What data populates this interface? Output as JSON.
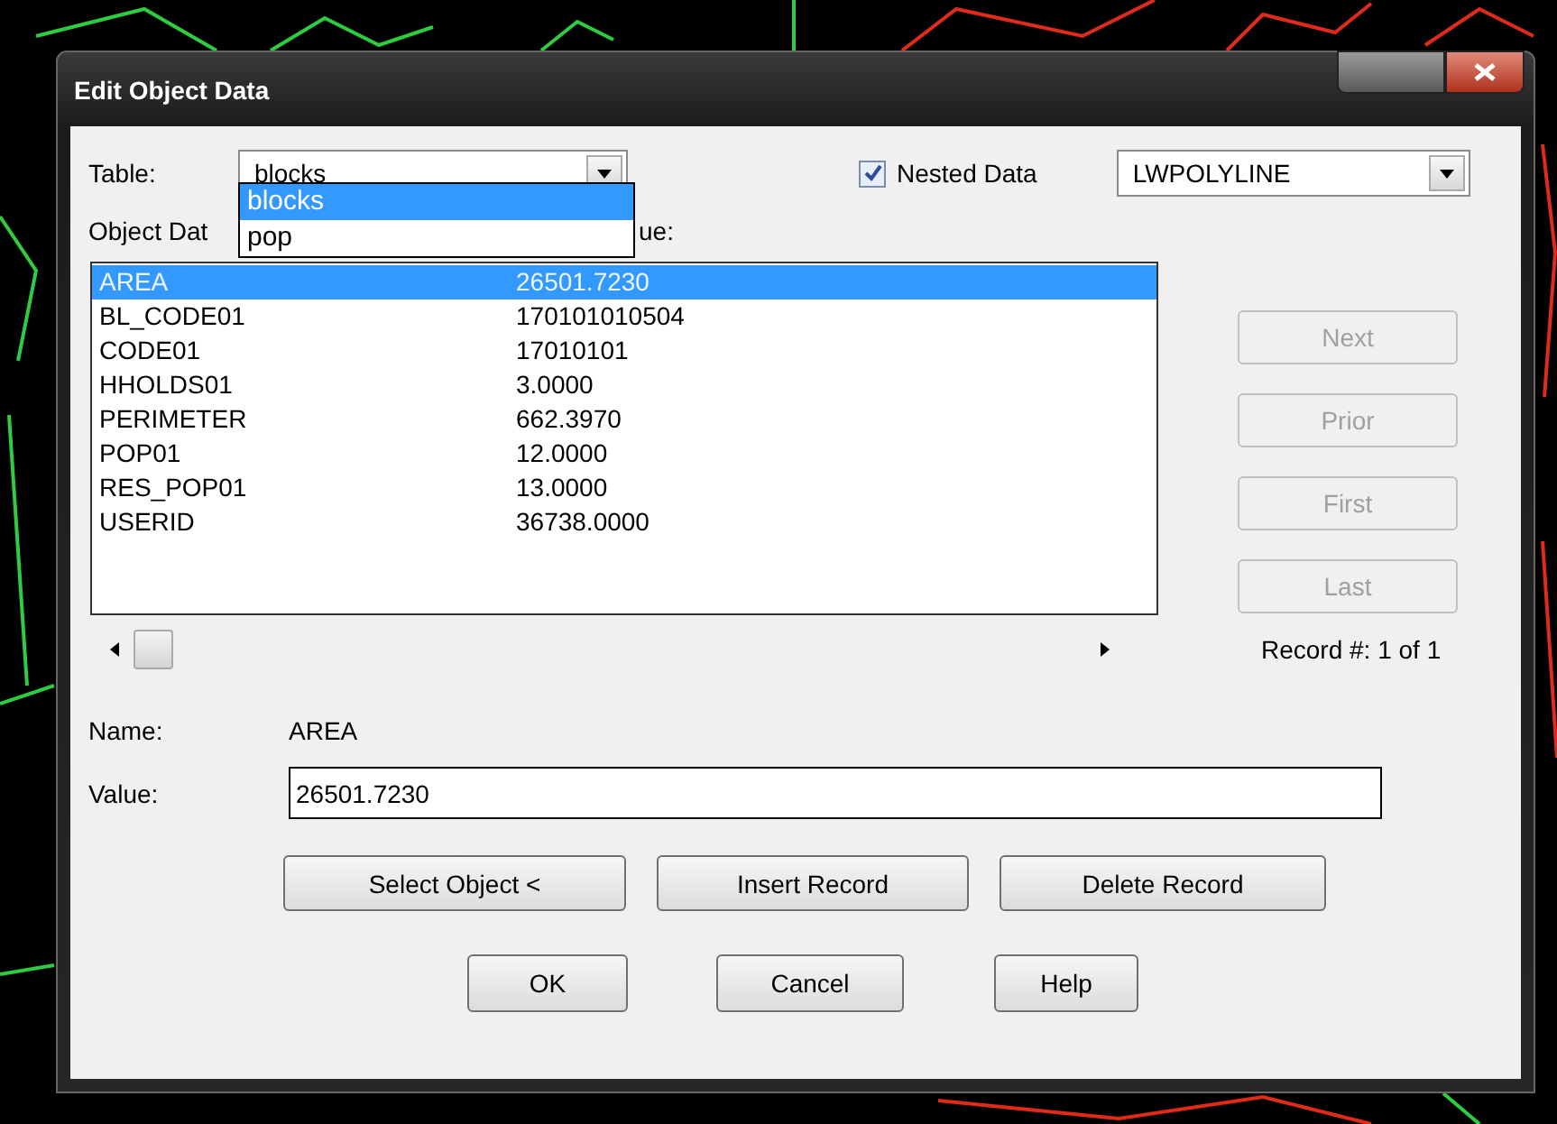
{
  "window": {
    "title": "Edit Object Data"
  },
  "table": {
    "label": "Table:",
    "value": "blocks",
    "options": [
      {
        "label": "blocks",
        "selected": true
      },
      {
        "label": "pop",
        "selected": false
      }
    ]
  },
  "nested_data": {
    "label": "Nested Data",
    "checked": true
  },
  "object_type": {
    "value": "LWPOLYLINE"
  },
  "list_headers": [
    "Object Dat",
    "ue:"
  ],
  "records": [
    {
      "name": "AREA",
      "value": "26501.7230",
      "selected": true
    },
    {
      "name": "BL_CODE01",
      "value": "170101010504",
      "selected": false
    },
    {
      "name": "CODE01",
      "value": "17010101",
      "selected": false
    },
    {
      "name": "HHOLDS01",
      "value": "3.0000",
      "selected": false
    },
    {
      "name": "PERIMETER",
      "value": "662.3970",
      "selected": false
    },
    {
      "name": "POP01",
      "value": "12.0000",
      "selected": false
    },
    {
      "name": "RES_POP01",
      "value": "13.0000",
      "selected": false
    },
    {
      "name": "USERID",
      "value": "36738.0000",
      "selected": false
    }
  ],
  "nav_buttons": [
    {
      "label": "Next",
      "disabled": true
    },
    {
      "label": "Prior",
      "disabled": true
    },
    {
      "label": "First",
      "disabled": true
    },
    {
      "label": "Last",
      "disabled": true
    }
  ],
  "record_counter": "Record #: 1 of 1",
  "name_field": {
    "label": "Name:",
    "value": "AREA"
  },
  "value_field": {
    "label": "Value:",
    "value": "26501.7230"
  },
  "action_buttons": [
    "Select Object <",
    "Insert Record",
    "Delete Record"
  ],
  "dialog_buttons": [
    "OK",
    "Cancel",
    "Help"
  ]
}
